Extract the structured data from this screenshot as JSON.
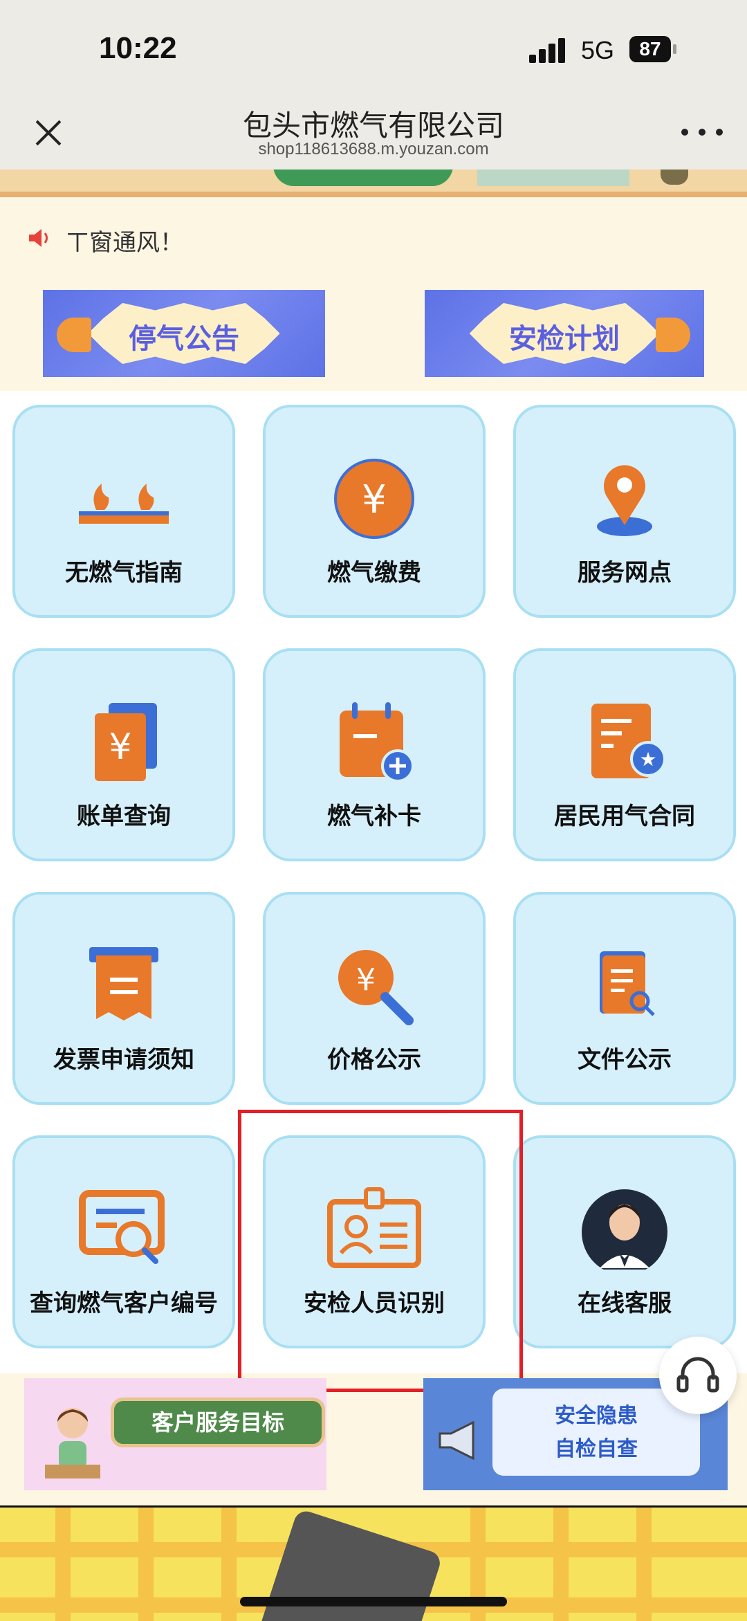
{
  "status": {
    "time": "10:22",
    "network": "5G",
    "battery": "87"
  },
  "nav": {
    "title": "包头市燃气有限公司",
    "url": "shop118613688.m.youzan.com"
  },
  "notice": {
    "text": "ㄒ窗通风！"
  },
  "banners": [
    {
      "label": "停气公告"
    },
    {
      "label": "安检计划"
    }
  ],
  "tiles": [
    {
      "label": "无燃气指南",
      "icon": "flame-icon"
    },
    {
      "label": "燃气缴费",
      "icon": "yuan-coin-icon"
    },
    {
      "label": "服务网点",
      "icon": "location-pin-icon"
    },
    {
      "label": "账单查询",
      "icon": "bill-icon"
    },
    {
      "label": "燃气补卡",
      "icon": "calendar-add-icon"
    },
    {
      "label": "居民用气合同",
      "icon": "contract-icon"
    },
    {
      "label": "发票申请须知",
      "icon": "invoice-icon"
    },
    {
      "label": "价格公示",
      "icon": "price-search-icon"
    },
    {
      "label": "文件公示",
      "icon": "document-search-icon"
    },
    {
      "label": "查询燃气客户编号",
      "icon": "search-card-icon"
    },
    {
      "label": "安检人员识别",
      "icon": "id-badge-icon"
    },
    {
      "label": "在线客服",
      "icon": "agent-icon"
    }
  ],
  "promos": {
    "left": "客户服务目标",
    "right_line1": "安全隐患",
    "right_line2": "自检自查"
  },
  "colors": {
    "accent": "#e8782a",
    "tile_bg": "#d6f0fb",
    "tile_border": "#a8dff3",
    "highlight": "#e21f26"
  }
}
